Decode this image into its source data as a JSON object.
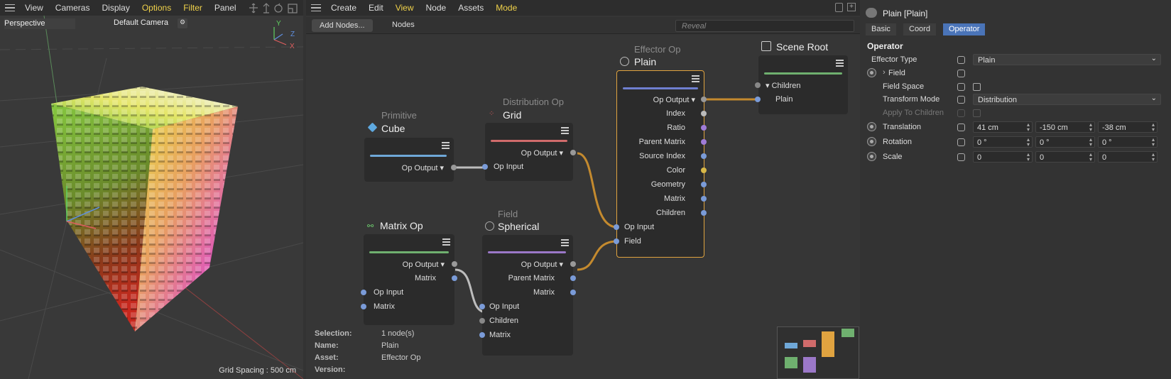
{
  "viewport": {
    "menu": [
      "View",
      "Cameras",
      "Display",
      "Options",
      "Filter",
      "Panel"
    ],
    "view_name": "Perspective",
    "camera": "Default Camera",
    "grid_spacing": "Grid Spacing : 500 cm",
    "axes": {
      "y": "Y",
      "z": "Z",
      "x": "X"
    }
  },
  "node_editor": {
    "menu": [
      "Create",
      "Edit",
      "View",
      "Node",
      "Assets",
      "Mode"
    ],
    "add_nodes": "Add Nodes...",
    "nodes_label": "Nodes",
    "reveal_placeholder": "Reveal",
    "nodes": {
      "cube": {
        "category": "Primitive",
        "name": "Cube",
        "ports": [
          "Op Output ▾"
        ]
      },
      "grid": {
        "category": "Distribution Op",
        "name": "Grid",
        "ports": [
          "Op Output ▾",
          "Op Input"
        ]
      },
      "plain": {
        "category": "Effector Op",
        "name": "Plain",
        "ports": [
          "Op Output ▾",
          "Index",
          "Ratio",
          "Parent Matrix",
          "Source Index",
          "Color",
          "Geometry",
          "Matrix",
          "Children",
          "Op Input",
          "Field"
        ]
      },
      "scene_root": {
        "name": "Scene Root",
        "ports": [
          "▾ Children",
          "Plain"
        ]
      },
      "matrix_op": {
        "name": "Matrix Op",
        "ports": [
          "Op Output ▾",
          "Matrix",
          "Op Input",
          "Matrix"
        ]
      },
      "spherical": {
        "category": "Field",
        "name": "Spherical",
        "ports": [
          "Op Output ▾",
          "Parent Matrix",
          "Matrix",
          "Op Input",
          "Children",
          "Matrix"
        ]
      }
    },
    "info": {
      "labels": [
        "Selection:",
        "Name:",
        "Asset:",
        "Version:"
      ],
      "values": [
        "1 node(s)",
        "Plain",
        "Effector Op",
        ""
      ]
    }
  },
  "attributes": {
    "title": "Plain [Plain]",
    "tabs": [
      "Basic",
      "Coord",
      "Operator"
    ],
    "section": "Operator",
    "props": {
      "effector_type": {
        "label": "Effector Type",
        "value": "Plain"
      },
      "field": {
        "label": "Field"
      },
      "field_space": {
        "label": "Field Space"
      },
      "transform_mode": {
        "label": "Transform Mode",
        "value": "Distribution"
      },
      "apply_children": {
        "label": "Apply To Children"
      },
      "translation": {
        "label": "Translation",
        "values": [
          "41 cm",
          "-150 cm",
          "-38 cm"
        ]
      },
      "rotation": {
        "label": "Rotation",
        "values": [
          "0 °",
          "0 °",
          "0 °"
        ]
      },
      "scale": {
        "label": "Scale",
        "values": [
          "0",
          "0",
          "0"
        ]
      }
    }
  },
  "colors": {
    "accent_blue": "#4a74b8",
    "wire_orange": "#c48a2e",
    "selected_border": "#e0a340",
    "menu_highlight": "#f0d24a"
  }
}
